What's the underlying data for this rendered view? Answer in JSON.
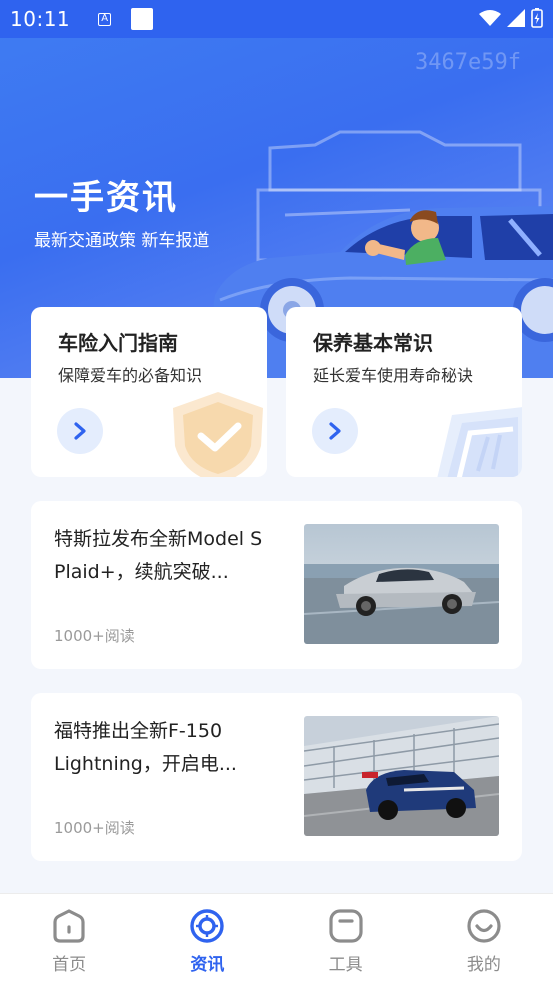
{
  "status_bar": {
    "time": "10:11",
    "a_icon": "A"
  },
  "hero": {
    "watermark": "3467e59f",
    "title": "一手资讯",
    "subtitle": "最新交通政策 新车报道"
  },
  "guides": [
    {
      "title": "车险入门指南",
      "subtitle": "保障爱车的必备知识",
      "icon": "shield-check-icon"
    },
    {
      "title": "保养基本常识",
      "subtitle": "延长爱车使用寿命秘诀",
      "icon": "book-icon"
    }
  ],
  "news": [
    {
      "title": "特斯拉发布全新Model S Plaid+，续航突破...",
      "reads": "1000+阅读",
      "image": "silver-sedan"
    },
    {
      "title": "福特推出全新F-150 Lightning，开启电...",
      "reads": "1000+阅读",
      "image": "race-car"
    }
  ],
  "tabs": [
    {
      "label": "首页",
      "icon": "home-icon"
    },
    {
      "label": "资讯",
      "icon": "news-icon",
      "active": true
    },
    {
      "label": "工具",
      "icon": "tools-icon"
    },
    {
      "label": "我的",
      "icon": "profile-icon"
    }
  ],
  "colors": {
    "primary": "#2f63ef",
    "tab_inactive": "#8c8c8c"
  }
}
